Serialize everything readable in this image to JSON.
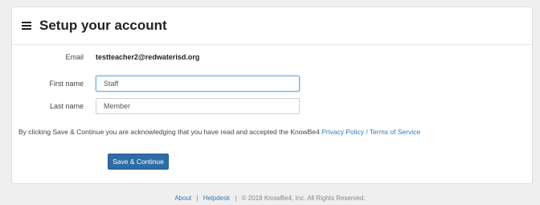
{
  "header": {
    "title": "Setup your account",
    "menu_icon": "hamburger-icon"
  },
  "form": {
    "email_label": "Email",
    "email_value": "testteacher2@redwaterisd.org",
    "first_name_label": "First name",
    "first_name_value": "Staff",
    "last_name_label": "Last name",
    "last_name_value": "Member"
  },
  "disclaimer": {
    "text": "By clicking Save & Continue you are acknowledging that you have read and accepted the KnowBe4 ",
    "link_text": "Privacy Policy / Terms of Service"
  },
  "actions": {
    "save_label": "Save & Continue"
  },
  "footer": {
    "about": "About",
    "separator": "|",
    "helpdesk": "Helpdesk",
    "copyright": "© 2018 KnowBe4, Inc. All Rights Reserved."
  },
  "colors": {
    "primary": "#2e6da4",
    "link": "#337ab7",
    "focus": "#66afe9"
  }
}
